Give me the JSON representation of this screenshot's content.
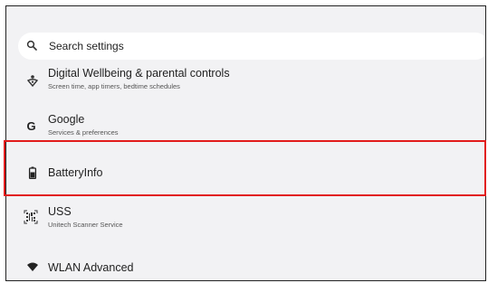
{
  "search": {
    "placeholder": "Search settings",
    "icon": "search-icon"
  },
  "items": [
    {
      "id": "digital-wellbeing",
      "title": "Digital Wellbeing & parental controls",
      "subtitle": "Screen time, app timers, bedtime schedules",
      "icon": "wellbeing-icon"
    },
    {
      "id": "google",
      "title": "Google",
      "subtitle": "Services & preferences",
      "icon": "google-icon"
    },
    {
      "id": "batteryinfo",
      "title": "BatteryInfo",
      "icon": "battery-icon",
      "highlighted": true
    },
    {
      "id": "uss",
      "title": "USS",
      "subtitle": "Unitech Scanner Service",
      "icon": "scanner-icon"
    },
    {
      "id": "wlan-advanced",
      "title": "WLAN Advanced",
      "icon": "wifi-icon"
    }
  ],
  "colors": {
    "background": "#f2f2f4",
    "highlight": "#e21b1b"
  }
}
